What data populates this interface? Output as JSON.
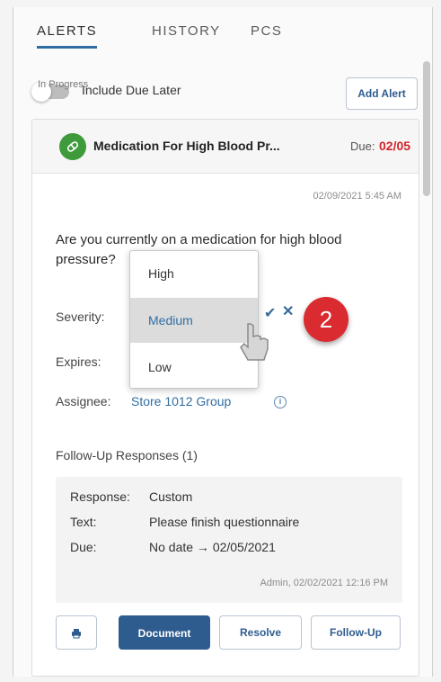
{
  "tabs": [
    {
      "label": "ALERTS",
      "active": true
    },
    {
      "label": "HISTORY",
      "active": false
    },
    {
      "label": "PCS",
      "active": false
    }
  ],
  "toolbar": {
    "toggle_label": "Include Due Later",
    "toggle_on": false,
    "add_alert_label": "Add Alert"
  },
  "alert": {
    "title": "Medication For High Blood Pr...",
    "due_label": "Due:",
    "due_date": "02/05",
    "status": "In Progress",
    "timestamp": "02/09/2021 5:45 AM",
    "question": "Are you currently on a medication for high blood pressure?",
    "severity_label": "Severity:",
    "expires_label": "Expires:",
    "assignee_label": "Assignee:",
    "assignee_value": "Store 1012 Group",
    "followup_title": "Follow-Up Responses (1)",
    "followup": {
      "response_key": "Response:",
      "response_val": "Custom",
      "text_key": "Text:",
      "text_val": "Please finish questionnaire",
      "due_key": "Due:",
      "due_val": "No date → 02/05/2021",
      "meta": "Admin, 02/02/2021 12:16 PM"
    },
    "buttons": {
      "document": "Document",
      "resolve": "Resolve",
      "followup": "Follow-Up"
    }
  },
  "severity_dropdown": {
    "options": [
      "High",
      "Medium",
      "Low"
    ],
    "selected": "Medium"
  },
  "step_badge": "2",
  "colors": {
    "accent": "#2f5c8f",
    "due_red": "#d3232a",
    "badge_red": "#d92b30",
    "avatar_green": "#3e9a3a"
  },
  "icons": [
    "medication-icon",
    "check-icon",
    "close-icon",
    "info-icon",
    "print-icon",
    "pointer-cursor-icon"
  ]
}
